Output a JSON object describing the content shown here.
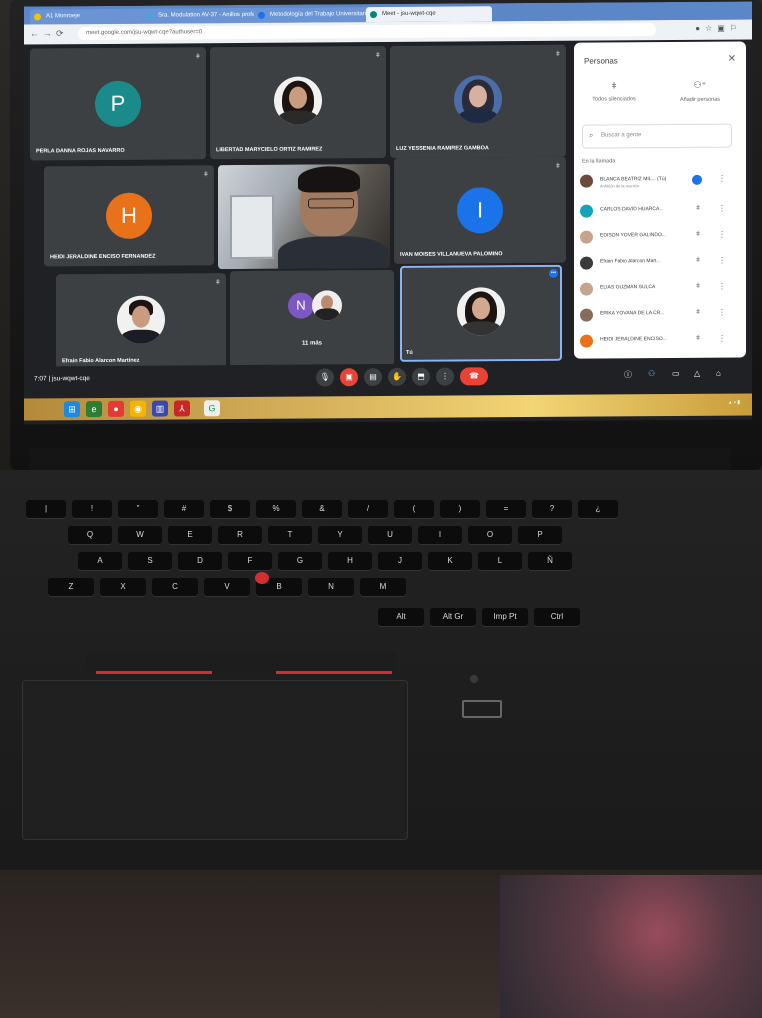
{
  "browser": {
    "tabs": [
      {
        "label": "A1 Monroeje"
      },
      {
        "label": "Sra. Modulation AV-37 - Anillos profesor"
      },
      {
        "label": "Metodología del Trabajo Universitario"
      },
      {
        "label": "Meet - jsu-wqwt-cqe"
      }
    ],
    "url": "meet.google.com/jsu-wqwt-cqe?authuser=0"
  },
  "grid": {
    "tiles": [
      {
        "name": "PERLA DANNA ROJAS NAVARRO",
        "initial": "P",
        "color": "#1b8a8a"
      },
      {
        "name": "LIBERTAD MARYCIELO ORTIZ RAMIREZ"
      },
      {
        "name": "LUZ YESSENIA RAMIREZ GAMBOA"
      },
      {
        "name": "HEIDI JERALDINE ENCISO FERNANDEZ",
        "initial": "H",
        "color": "#e8711a"
      },
      {
        "name": ""
      },
      {
        "name": "IVAN MOISES VILLANUEVA PALOMINO",
        "initial": "I",
        "color": "#1a73e8"
      },
      {
        "name": "Efrain Fabio Alarcon Martinez"
      },
      {
        "initial": "N",
        "more_label": "11 más"
      },
      {
        "name": "Tú"
      }
    ]
  },
  "panel": {
    "title": "Personas",
    "close": "✕",
    "add_all": "Todos silenciados",
    "add_people": "Añadir personas",
    "search_placeholder": "Buscar a gente",
    "section": "En la llamada",
    "people": [
      {
        "name": "BLANCA BEATRIZ MIL... (Tú)",
        "sub": "Anfitrión de la reunión"
      },
      {
        "name": "CARLOS DAVID HUARCA..."
      },
      {
        "name": "EDISON YOVER GALINDO..."
      },
      {
        "name": "Efrain Fabio Alarcon Mart..."
      },
      {
        "name": "ELIAS GUZMAN SULCA"
      },
      {
        "name": "ERIKA YOVANA DE LA CR..."
      },
      {
        "name": "HEIDI JERALDINE ENCISO..."
      }
    ]
  },
  "meetbar": {
    "time": "7:07",
    "separator": "|",
    "code": "jsu-wqwt-cqe"
  },
  "keyboard": {
    "row1": [
      "|",
      "!",
      "\"",
      "#",
      "$",
      "%",
      "&",
      "/",
      "(",
      ")",
      "=",
      "?",
      "¿"
    ],
    "row2": [
      "Q",
      "W",
      "E",
      "R",
      "T",
      "Y",
      "U",
      "I",
      "O",
      "P"
    ],
    "row3": [
      "A",
      "S",
      "D",
      "F",
      "G",
      "H",
      "J",
      "K",
      "L",
      "Ñ"
    ],
    "row4": [
      "Z",
      "X",
      "C",
      "V",
      "B",
      "N",
      "M"
    ],
    "bottom": [
      "Alt",
      "Alt Gr",
      "Imp Pt",
      "Ctrl"
    ]
  }
}
